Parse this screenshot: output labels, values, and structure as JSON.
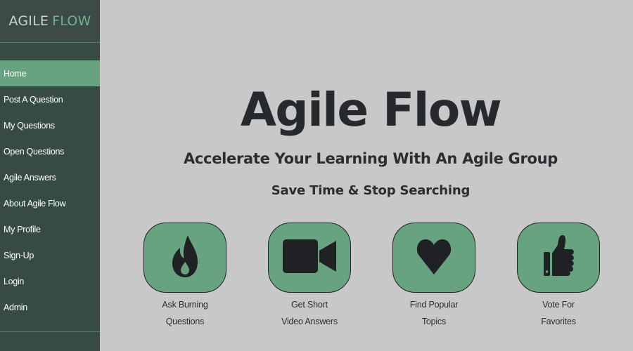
{
  "brand": {
    "part1": "AGILE",
    "part2": "FLOW"
  },
  "nav": {
    "items": [
      {
        "label": "Home"
      },
      {
        "label": "Post A Question"
      },
      {
        "label": "My Questions"
      },
      {
        "label": "Open Questions"
      },
      {
        "label": "Agile Answers"
      },
      {
        "label": "About Agile Flow"
      },
      {
        "label": "My Profile"
      },
      {
        "label": "Sign-Up"
      },
      {
        "label": "Login"
      },
      {
        "label": "Admin"
      }
    ],
    "active": "Home"
  },
  "hero": {
    "title": "Agile Flow",
    "subtitle": "Accelerate Your Learning With An Agile Group",
    "tagline": "Save Time & Stop Searching"
  },
  "features": [
    {
      "icon": "fire-icon",
      "line1": "Ask Burning",
      "line2": "Questions"
    },
    {
      "icon": "video-camera-icon",
      "line1": "Get Short",
      "line2": "Video Answers"
    },
    {
      "icon": "heart-icon",
      "line1": "Find Popular",
      "line2": "Topics"
    },
    {
      "icon": "thumbs-up-icon",
      "line1": "Vote For",
      "line2": "Favorites"
    }
  ],
  "colors": {
    "sidebar_bg": "#364c43",
    "brand_bg": "#3c4a48",
    "accent_green": "#66a37e",
    "page_bg": "#c8c8c8",
    "text_dark": "#26292d"
  }
}
